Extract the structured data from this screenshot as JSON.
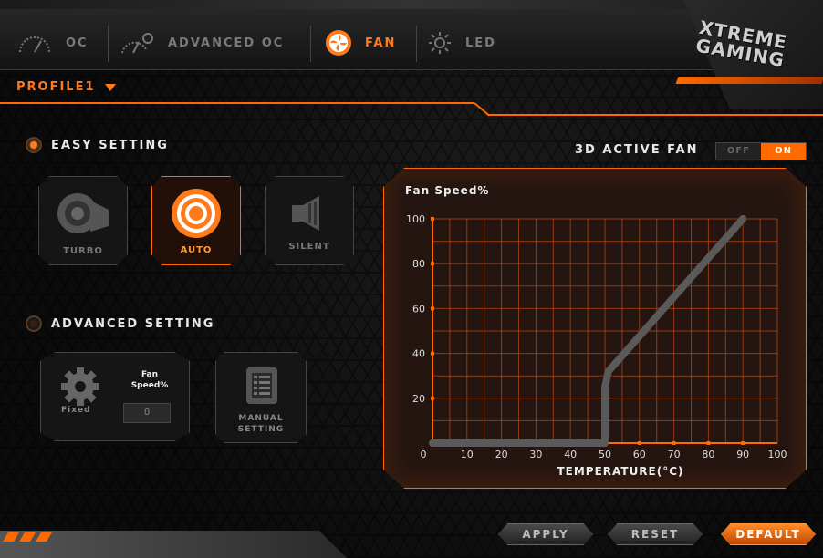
{
  "nav": {
    "tabs": [
      {
        "label": "OC"
      },
      {
        "label": "ADVANCED OC"
      },
      {
        "label": "FAN"
      },
      {
        "label": "LED"
      }
    ],
    "active_tab": "FAN",
    "brand_line1": "XTREME",
    "brand_line2": "GAMING"
  },
  "profile": {
    "label": "PROFILE1"
  },
  "easy_setting": {
    "title": "EASY SETTING",
    "modes": [
      {
        "label": "TURBO",
        "icon": "turbo-fan-icon"
      },
      {
        "label": "AUTO",
        "icon": "auto-target-icon"
      },
      {
        "label": "SILENT",
        "icon": "silent-speaker-icon"
      }
    ],
    "selected": "AUTO"
  },
  "advanced_setting": {
    "title": "ADVANCED SETTING",
    "fixed_label": "Fixed",
    "fan_speed_label_1": "Fan",
    "fan_speed_label_2": "Speed%",
    "fan_speed_value": "0",
    "manual_label_1": "MANUAL",
    "manual_label_2": "SETTING"
  },
  "active_fan": {
    "label": "3D ACTIVE FAN",
    "off": "OFF",
    "on": "ON",
    "state": "ON"
  },
  "chart_data": {
    "type": "line",
    "title": "Fan Speed%",
    "xlabel": "TEMPERATURE(°C)",
    "ylabel": "",
    "x_ticks": [
      0,
      10,
      20,
      30,
      40,
      50,
      60,
      70,
      80,
      90,
      100
    ],
    "y_ticks": [
      0,
      20,
      40,
      60,
      80,
      100
    ],
    "xlim": [
      0,
      100
    ],
    "ylim": [
      0,
      100
    ],
    "series": [
      {
        "x": [
          0,
          50,
          50,
          51,
          90
        ],
        "y": [
          0,
          0,
          25,
          32,
          100
        ]
      }
    ],
    "colors": {
      "line": "#5a5a5a",
      "grid": "#c04a10",
      "axis": "#ff6a00"
    }
  },
  "buttons": {
    "apply": "APPLY",
    "reset": "RESET",
    "default": "DEFAULT"
  },
  "colors": {
    "accent": "#ff6a00",
    "bg": "#0a0a0a"
  }
}
